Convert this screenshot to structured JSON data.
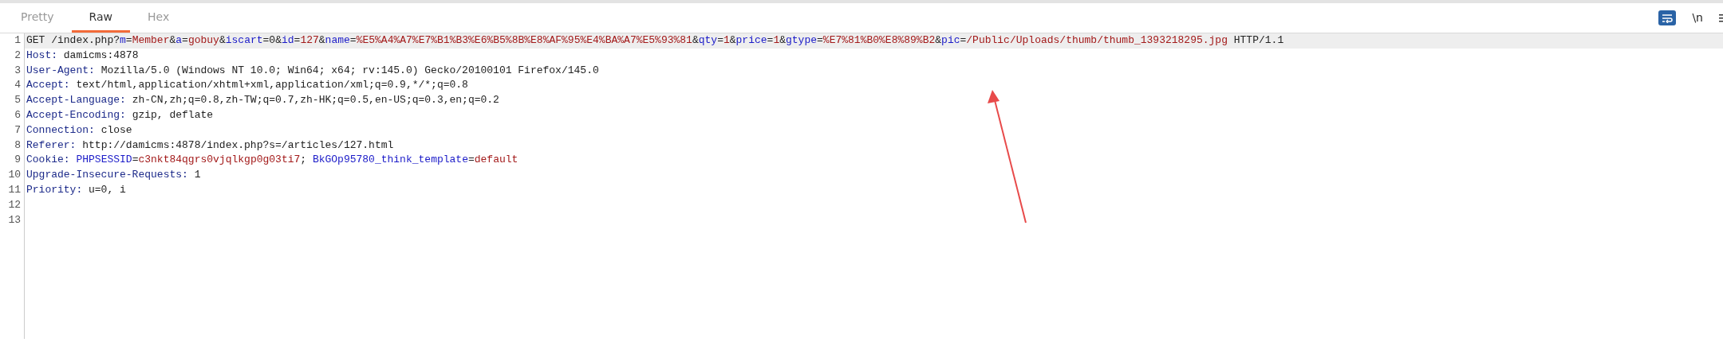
{
  "tabs": [
    {
      "label": "Pretty",
      "selected": false
    },
    {
      "label": "Raw",
      "selected": true
    },
    {
      "label": "Hex",
      "selected": false
    }
  ],
  "toolbar": {
    "wrap": {
      "on": true
    },
    "newline": {
      "label": "\\n",
      "on": false
    }
  },
  "lines": [
    {
      "number": "1",
      "current": true,
      "tokens": [
        {
          "kind": "plain",
          "text": "GET /index.php?"
        },
        {
          "kind": "param",
          "text": "m"
        },
        {
          "kind": "plain",
          "text": "="
        },
        {
          "kind": "value",
          "text": "Member"
        },
        {
          "kind": "plain",
          "text": "&"
        },
        {
          "kind": "param",
          "text": "a"
        },
        {
          "kind": "plain",
          "text": "="
        },
        {
          "kind": "value",
          "text": "gobuy"
        },
        {
          "kind": "plain",
          "text": "&"
        },
        {
          "kind": "param",
          "text": "iscart"
        },
        {
          "kind": "plain",
          "text": "=0&"
        },
        {
          "kind": "param",
          "text": "id"
        },
        {
          "kind": "plain",
          "text": "="
        },
        {
          "kind": "value",
          "text": "127"
        },
        {
          "kind": "plain",
          "text": "&"
        },
        {
          "kind": "param",
          "text": "name"
        },
        {
          "kind": "plain",
          "text": "="
        },
        {
          "kind": "value",
          "text": "%E5%A4%A7%E7%B1%B3%E6%B5%8B%E8%AF%95%E4%BA%A7%E5%93%81"
        },
        {
          "kind": "plain",
          "text": "&"
        },
        {
          "kind": "param",
          "text": "qty"
        },
        {
          "kind": "plain",
          "text": "="
        },
        {
          "kind": "value",
          "text": "1"
        },
        {
          "kind": "plain",
          "text": "&"
        },
        {
          "kind": "param",
          "text": "price"
        },
        {
          "kind": "plain",
          "text": "="
        },
        {
          "kind": "value",
          "text": "1"
        },
        {
          "kind": "plain",
          "text": "&"
        },
        {
          "kind": "param",
          "text": "gtype"
        },
        {
          "kind": "plain",
          "text": "="
        },
        {
          "kind": "value",
          "text": "%E7%81%B0%E8%89%B2"
        },
        {
          "kind": "plain",
          "text": "&"
        },
        {
          "kind": "param",
          "text": "pic"
        },
        {
          "kind": "plain",
          "text": "="
        },
        {
          "kind": "value",
          "text": "/Public/Uploads/thumb/thumb_1393218295.jpg"
        },
        {
          "kind": "plain",
          "text": " HTTP/1.1"
        }
      ]
    },
    {
      "number": "2",
      "current": false,
      "tokens": [
        {
          "kind": "header",
          "text": "Host:"
        },
        {
          "kind": "plain",
          "text": " damicms:4878"
        }
      ]
    },
    {
      "number": "3",
      "current": false,
      "tokens": [
        {
          "kind": "header",
          "text": "User-Agent:"
        },
        {
          "kind": "plain",
          "text": " Mozilla/5.0 (Windows NT 10.0; Win64; x64; rv:145.0) Gecko/20100101 Firefox/145.0"
        }
      ]
    },
    {
      "number": "4",
      "current": false,
      "tokens": [
        {
          "kind": "header",
          "text": "Accept:"
        },
        {
          "kind": "plain",
          "text": " text/html,application/xhtml+xml,application/xml;q=0.9,*/*;q=0.8"
        }
      ]
    },
    {
      "number": "5",
      "current": false,
      "tokens": [
        {
          "kind": "header",
          "text": "Accept-Language:"
        },
        {
          "kind": "plain",
          "text": " zh-CN,zh;q=0.8,zh-TW;q=0.7,zh-HK;q=0.5,en-US;q=0.3,en;q=0.2"
        }
      ]
    },
    {
      "number": "6",
      "current": false,
      "tokens": [
        {
          "kind": "header",
          "text": "Accept-Encoding:"
        },
        {
          "kind": "plain",
          "text": " gzip, deflate"
        }
      ]
    },
    {
      "number": "7",
      "current": false,
      "tokens": [
        {
          "kind": "header",
          "text": "Connection:"
        },
        {
          "kind": "plain",
          "text": " close"
        }
      ]
    },
    {
      "number": "8",
      "current": false,
      "tokens": [
        {
          "kind": "header",
          "text": "Referer:"
        },
        {
          "kind": "plain",
          "text": " http://damicms:4878/index.php?s=/articles/127.html"
        }
      ]
    },
    {
      "number": "9",
      "current": false,
      "tokens": [
        {
          "kind": "header",
          "text": "Cookie: "
        },
        {
          "kind": "param",
          "text": "PHPSESSID"
        },
        {
          "kind": "plain",
          "text": "="
        },
        {
          "kind": "value",
          "text": "c3nkt84qgrs0vjqlkgp0g03ti7"
        },
        {
          "kind": "plain",
          "text": "; "
        },
        {
          "kind": "param",
          "text": "BkGOp95780_think_template"
        },
        {
          "kind": "plain",
          "text": "="
        },
        {
          "kind": "value",
          "text": "default"
        }
      ]
    },
    {
      "number": "10",
      "current": false,
      "tokens": [
        {
          "kind": "header",
          "text": "Upgrade-Insecure-Requests:"
        },
        {
          "kind": "plain",
          "text": " 1"
        }
      ]
    },
    {
      "number": "11",
      "current": false,
      "tokens": [
        {
          "kind": "header",
          "text": "Priority:"
        },
        {
          "kind": "plain",
          "text": " u=0, i"
        }
      ]
    },
    {
      "number": "12",
      "current": false
    },
    {
      "number": "13",
      "current": false
    }
  ],
  "annotations": [
    {
      "kind": "arrow"
    }
  ]
}
